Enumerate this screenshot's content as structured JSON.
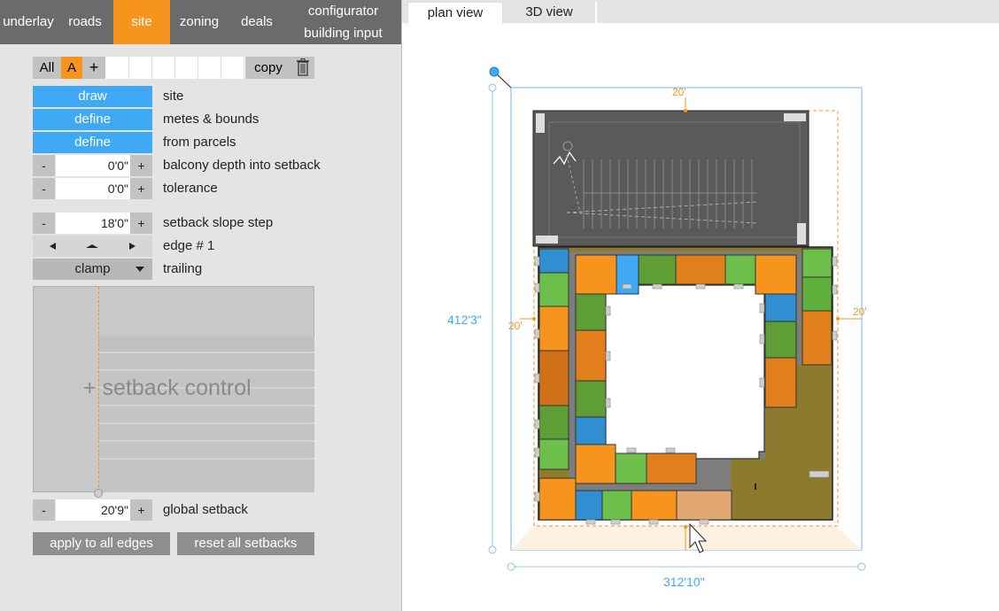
{
  "nav": {
    "items": [
      "underlay",
      "roads",
      "site",
      "zoning",
      "deals"
    ],
    "stacked": [
      "configurator",
      "building input"
    ],
    "active": "site"
  },
  "toolbar": {
    "all": "All",
    "a": "A",
    "add": "+",
    "copy": "copy"
  },
  "site": {
    "draw": "draw",
    "draw_label": "site",
    "define1": "define",
    "define1_label": "metes & bounds",
    "define2": "define",
    "define2_label": "from parcels"
  },
  "balcony": {
    "value": "0'0\"",
    "label": "balcony depth into setback"
  },
  "tolerance": {
    "value": "0'0\"",
    "label": "tolerance"
  },
  "slope": {
    "value": "18'0\"",
    "label": "setback slope step"
  },
  "edge": {
    "label": "edge # 1"
  },
  "clamp": {
    "value": "clamp",
    "label": "trailing"
  },
  "setback_control": {
    "label": "+ setback control"
  },
  "global": {
    "value": "20'9\"",
    "label": "global setback"
  },
  "actions": {
    "apply": "apply to all edges",
    "reset": "reset all setbacks"
  },
  "buttons": {
    "minus": "-",
    "plus": "+"
  },
  "tabs": [
    "plan view",
    "3D view"
  ],
  "plan": {
    "height": "412'3\"",
    "width": "312'10\"",
    "setback_top": "20'",
    "setback_left": "20'",
    "setback_right": "20'"
  },
  "colors": {
    "accent": "#f7941d",
    "blue": "#3fa9f5",
    "green": "#6cbf4a",
    "olive": "#8a7a2e"
  }
}
